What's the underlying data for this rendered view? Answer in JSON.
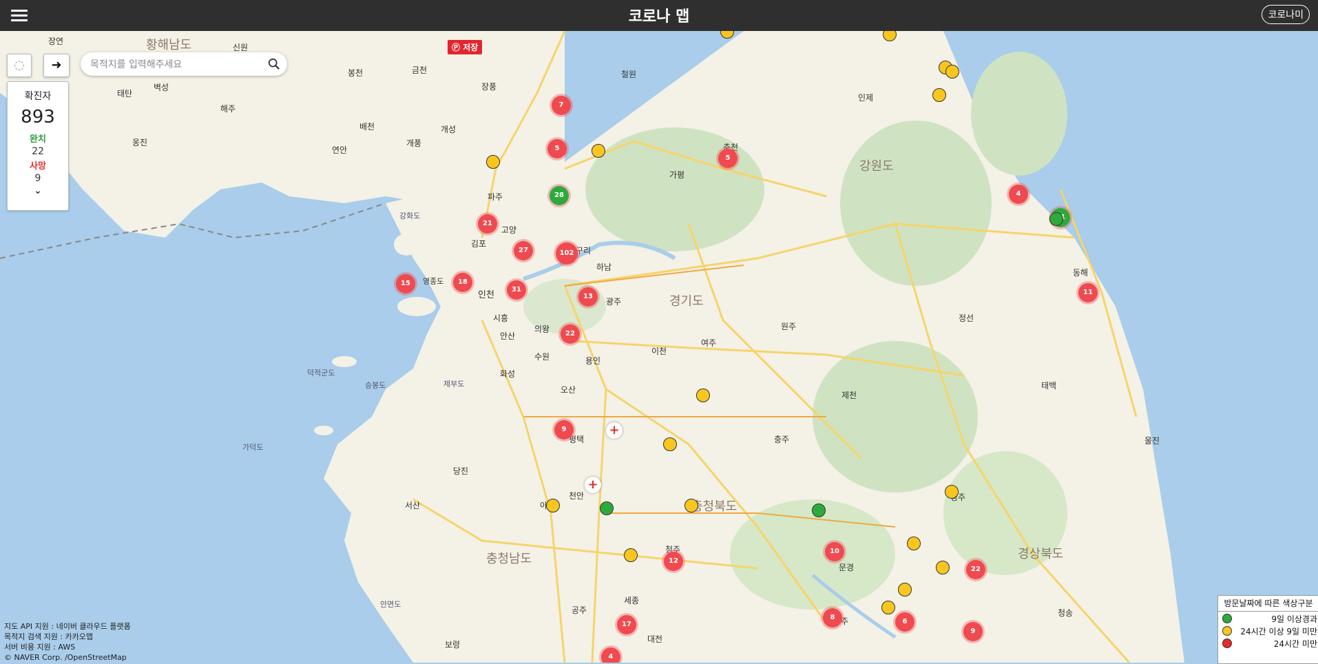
{
  "header": {
    "menu_icon": "hamburger-icon",
    "title": "코로나 맵",
    "user_button": "코로나미"
  },
  "search": {
    "placeholder": "목적지를 입력해주세요",
    "value": ""
  },
  "controls": {
    "loading_icon": "spinner-icon",
    "go_icon": "arrow-right-icon",
    "save_label": "저장"
  },
  "stats": {
    "confirmed_label": "확진자",
    "confirmed_value": "893",
    "recovered_label": "완치",
    "recovered_value": "22",
    "death_label": "사망",
    "death_value": "9",
    "expand_icon": "chevron-down-icon"
  },
  "credits": [
    "지도 API 지원 : 네이버 클라우드 플랫폼",
    "목적지 검색 지원 : 카카오맵",
    "서버 비용 지원 : AWS",
    "© NAVER Corp. /OpenStreetMap"
  ],
  "legend": {
    "title": "방문날짜에 따른 색상구분",
    "items": [
      {
        "label": "9일 이상경과",
        "color": "#2eaa3c"
      },
      {
        "label": "24시간 이상 9일 미만",
        "color": "#f9c51f"
      },
      {
        "label": "24시간 미만",
        "color": "#e52b2b"
      }
    ]
  },
  "colors": {
    "cluster": "#ef4a4f",
    "green": "#2eaa3c",
    "yellow": "#f9c51f",
    "hospital": "#e52b2b",
    "water": "#a9cdea",
    "land": "#f4f1e6"
  },
  "regions": [
    "황해남도",
    "강원도",
    "경기도",
    "충청북도",
    "충청남도",
    "경상북도"
  ],
  "places": [
    "장연",
    "신원",
    "봉천",
    "금천",
    "장풍",
    "철원",
    "태탄",
    "벽성",
    "해주",
    "배천",
    "옹진",
    "연안",
    "개풍",
    "개성",
    "파주",
    "고양",
    "김포",
    "인천",
    "영종도",
    "시흥",
    "안산",
    "의왕",
    "수원",
    "화성",
    "오산",
    "평택",
    "용인",
    "이천",
    "여주",
    "광주",
    "하남",
    "구리",
    "가평",
    "춘천",
    "인제",
    "원주",
    "제천",
    "충주",
    "정선",
    "동해",
    "태백",
    "울진",
    "영주",
    "문경",
    "상주",
    "청주",
    "세종",
    "공주",
    "천안",
    "아산",
    "당진",
    "서산",
    "보령",
    "대전",
    "강화도",
    "덕적군도",
    "승봉도",
    "제부도",
    "가덕도",
    "안면도",
    "청송"
  ],
  "clusters": [
    "7",
    "5",
    "5",
    "28",
    "21",
    "27",
    "102",
    "15",
    "18",
    "31",
    "13",
    "22",
    "9",
    "4",
    "11",
    "11",
    "10",
    "12",
    "17",
    "22",
    "8",
    "6",
    "9",
    "4"
  ],
  "markers": {
    "hospital_icon": "cross-icon",
    "pin_icon": "circle-marker-icon"
  }
}
